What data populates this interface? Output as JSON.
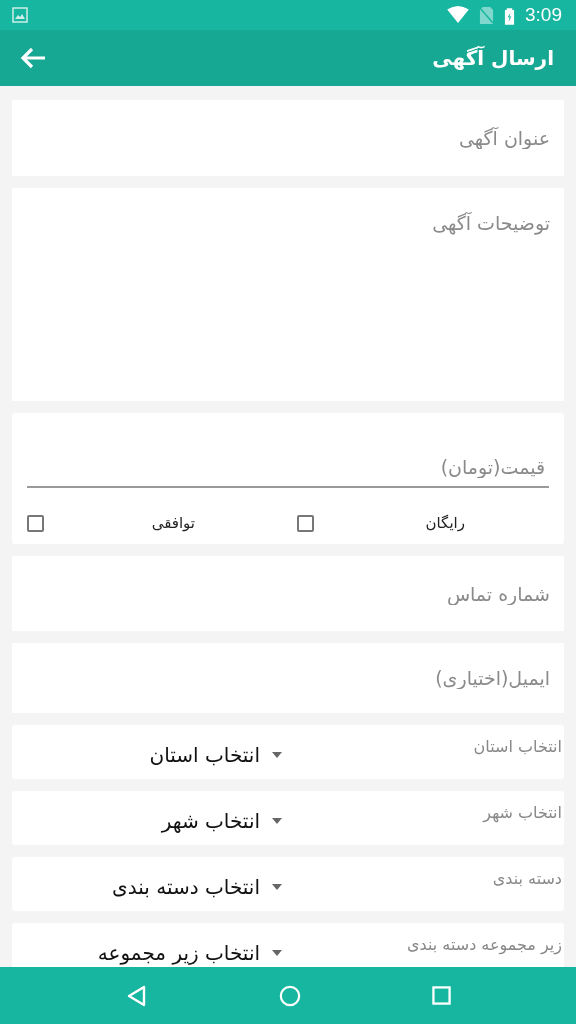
{
  "status_bar": {
    "time": "3:09"
  },
  "app_bar": {
    "title": "ارسال آگهی"
  },
  "fields": [
    {
      "kind": "text",
      "placeholder": "عنوان آگهی"
    },
    {
      "kind": "multiline",
      "placeholder": "توضیحات آگهی"
    },
    {
      "kind": "price",
      "placeholder": "قیمت(تومان)",
      "options": [
        {
          "label": "رایگان",
          "checked": false
        },
        {
          "label": "توافقی",
          "checked": false
        }
      ]
    },
    {
      "kind": "text",
      "placeholder": "شماره تماس"
    },
    {
      "kind": "text",
      "placeholder": "ایمیل(اختیاری)"
    }
  ],
  "spinners": [
    {
      "label": "انتخاب استان",
      "value": "انتخاب استان"
    },
    {
      "label": "انتخاب شهر",
      "value": "انتخاب شهر"
    },
    {
      "label": "دسته بندی",
      "value": "انتخاب دسته بندی"
    },
    {
      "label": "زیر مجموعه دسته بندی",
      "value": "انتخاب زیر مجموعه"
    }
  ]
}
